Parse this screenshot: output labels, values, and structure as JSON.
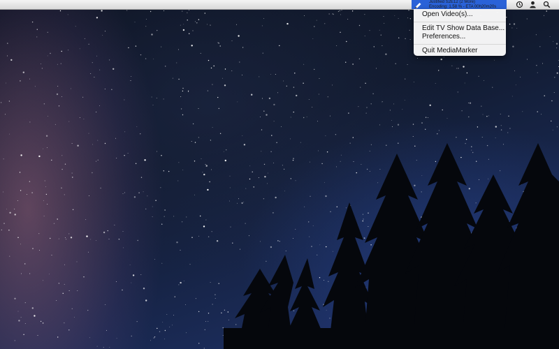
{
  "menubar": {
    "status_item": {
      "icon": "pencil-icon",
      "line1": "Justified S2E12 (2 More)",
      "line2": "Encoding: 1.58 % - ETA 00h20m20s",
      "accent": "#2a62d8"
    },
    "right_icons": [
      "time-machine-icon",
      "user-icon",
      "spotlight-search-icon"
    ]
  },
  "dropdown": {
    "items": [
      {
        "label": "Open Video(s)..."
      },
      {
        "label": "Edit TV Show Data Base..."
      },
      {
        "label": "Preferences..."
      },
      {
        "label": "Quit MediaMarker"
      }
    ]
  },
  "desktop": {
    "wallpaper": "starry-night-sky-with-milky-way-and-pine-tree-silhouettes"
  }
}
